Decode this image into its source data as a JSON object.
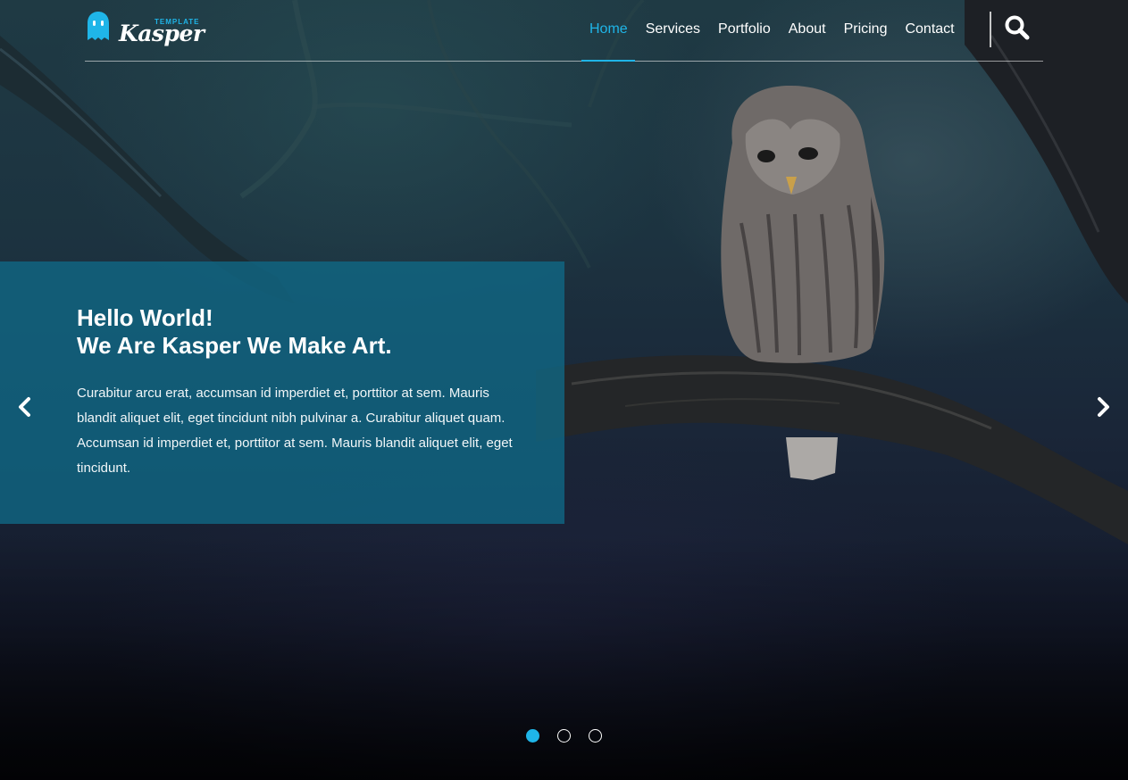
{
  "brand": {
    "logo_small": "TEMPLATE",
    "logo_name": "Kasper",
    "accent_color": "#1fb5e8"
  },
  "nav": {
    "items": [
      {
        "label": "Home",
        "active": true
      },
      {
        "label": "Services",
        "active": false
      },
      {
        "label": "Portfolio",
        "active": false
      },
      {
        "label": "About",
        "active": false
      },
      {
        "label": "Pricing",
        "active": false
      },
      {
        "label": "Contact",
        "active": false
      }
    ],
    "search_icon": "search-icon"
  },
  "hero": {
    "title_line1": "Hello World!",
    "title_line2": "We Are Kasper We Make Art.",
    "text": "Curabitur arcu erat, accumsan id imperdiet et, porttitor at sem. Mauris blandit aliquet elit, eget tincidunt nibh pulvinar a. Curabitur aliquet quam. Accumsan id imperdiet et, porttitor at sem. Mauris blandit aliquet elit, eget tincidunt.",
    "prev_icon": "chevron-left-icon",
    "next_icon": "chevron-right-icon",
    "slides_total": 3,
    "slide_active": 1
  }
}
